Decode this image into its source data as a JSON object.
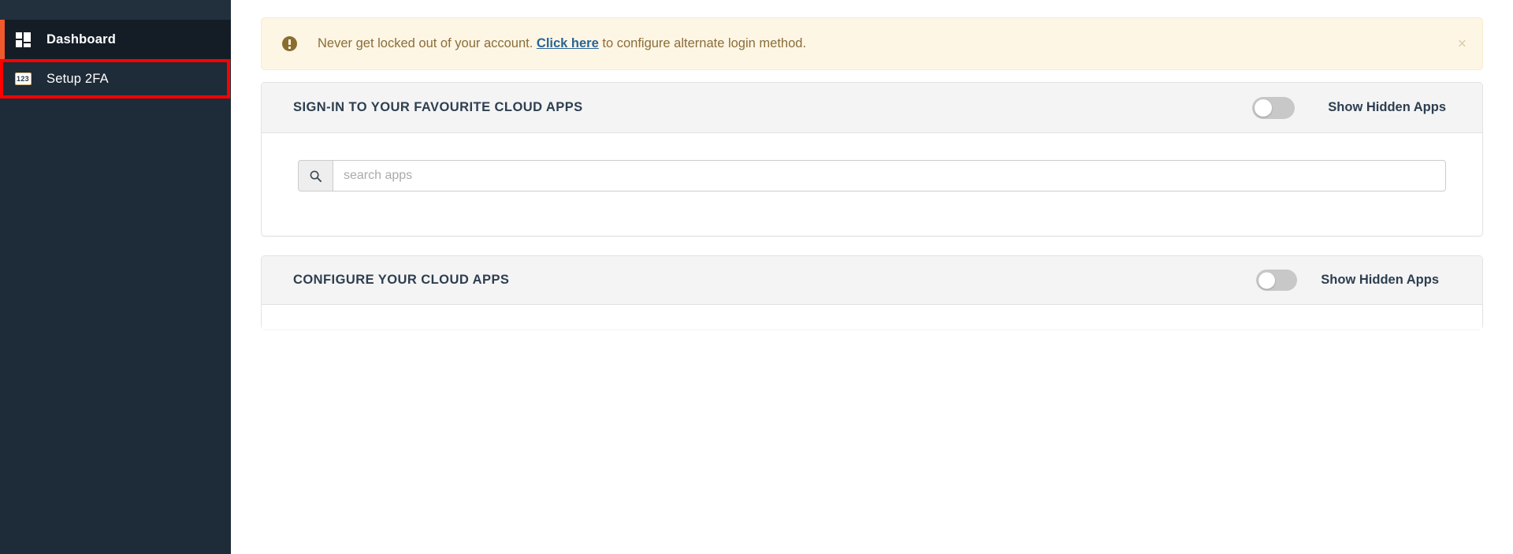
{
  "sidebar": {
    "items": [
      {
        "label": "Dashboard",
        "icon": "grid-icon",
        "active": true
      },
      {
        "label": "Setup 2FA",
        "icon": "keypad-123-icon",
        "active": false
      }
    ]
  },
  "alert": {
    "icon": "exclamation-circle-icon",
    "text_before": "Never get locked out of your account. ",
    "link_text": "Click here",
    "text_after": " to configure alternate login method.",
    "close_label": "×",
    "background_color": "#fdf6e4",
    "text_color": "#8a6d3b",
    "link_color": "#2a6496"
  },
  "panels": [
    {
      "title": "SIGN-IN TO YOUR FAVOURITE CLOUD APPS",
      "toggle_label": "Show Hidden Apps",
      "toggle_state": "off",
      "search": {
        "icon": "search-icon",
        "placeholder": "search apps",
        "value": ""
      }
    },
    {
      "title": "CONFIGURE YOUR CLOUD APPS",
      "toggle_label": "Show Hidden Apps",
      "toggle_state": "off"
    }
  ],
  "annotation": {
    "highlight_target": "Setup 2FA",
    "color": "#fe0000"
  },
  "theme": {
    "sidebar_bg": "#1e2b38",
    "sidebar_active_bg": "#141d26",
    "accent": "#f0592b",
    "panel_head_bg": "#f4f4f4",
    "title_color": "#2d3e50"
  }
}
